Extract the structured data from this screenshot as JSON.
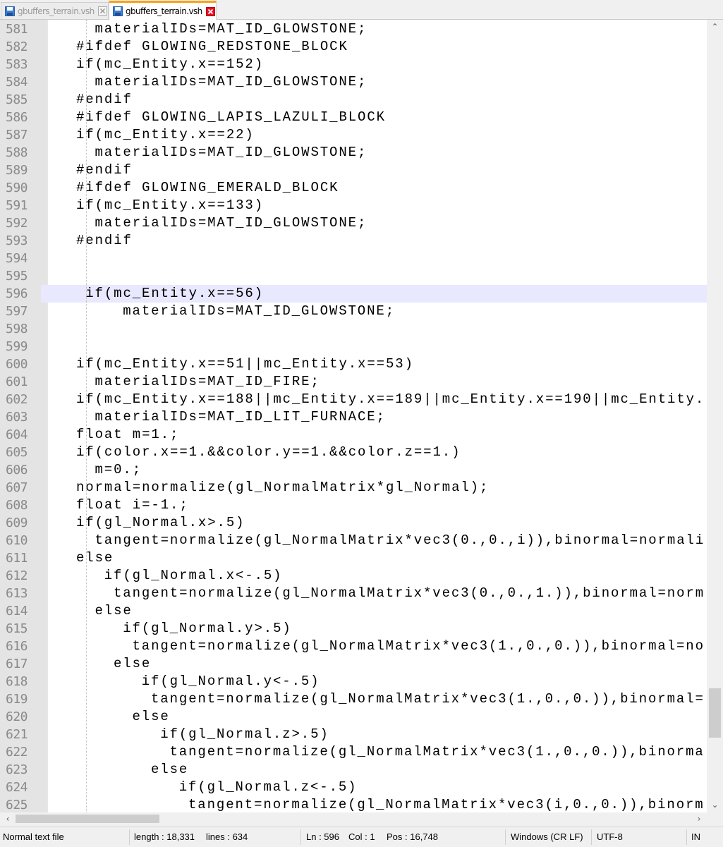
{
  "tabs": [
    {
      "label": "gbuffers_terrain.vsh",
      "active": false,
      "icon": "save-disk-icon",
      "close_icon": "close-red-icon"
    },
    {
      "label": "gbuffers_terrain.vsh",
      "active": true,
      "icon": "save-disk-icon",
      "close_icon": "close-red-icon"
    }
  ],
  "editor": {
    "current_line": 596,
    "lines": [
      {
        "n": "581",
        "indent": 5,
        "text": "materialIDs=MAT_ID_GLOWSTONE;"
      },
      {
        "n": "582",
        "indent": 4,
        "text": "#ifdef GLOWING_REDSTONE_BLOCK"
      },
      {
        "n": "583",
        "indent": 4,
        "text": "if(mc_Entity.x==152)"
      },
      {
        "n": "584",
        "indent": 5,
        "text": "materialIDs=MAT_ID_GLOWSTONE;"
      },
      {
        "n": "585",
        "indent": 4,
        "text": "#endif"
      },
      {
        "n": "586",
        "indent": 4,
        "text": "#ifdef GLOWING_LAPIS_LAZULI_BLOCK"
      },
      {
        "n": "587",
        "indent": 4,
        "text": "if(mc_Entity.x==22)"
      },
      {
        "n": "588",
        "indent": 5,
        "text": "materialIDs=MAT_ID_GLOWSTONE;"
      },
      {
        "n": "589",
        "indent": 4,
        "text": "#endif"
      },
      {
        "n": "590",
        "indent": 4,
        "text": "#ifdef GLOWING_EMERALD_BLOCK"
      },
      {
        "n": "591",
        "indent": 4,
        "text": "if(mc_Entity.x==133)"
      },
      {
        "n": "592",
        "indent": 5,
        "text": "materialIDs=MAT_ID_GLOWSTONE;"
      },
      {
        "n": "593",
        "indent": 4,
        "text": "#endif"
      },
      {
        "n": "594",
        "indent": 0,
        "text": ""
      },
      {
        "n": "595",
        "indent": 0,
        "text": ""
      },
      {
        "n": "596",
        "indent": 4.5,
        "text": "if(mc_Entity.x==56)"
      },
      {
        "n": "597",
        "indent": 6.5,
        "text": "materialIDs=MAT_ID_GLOWSTONE;"
      },
      {
        "n": "598",
        "indent": 0,
        "text": ""
      },
      {
        "n": "599",
        "indent": 0,
        "text": ""
      },
      {
        "n": "600",
        "indent": 4,
        "text": "if(mc_Entity.x==51||mc_Entity.x==53)"
      },
      {
        "n": "601",
        "indent": 5,
        "text": "materialIDs=MAT_ID_FIRE;"
      },
      {
        "n": "602",
        "indent": 4,
        "text": "if(mc_Entity.x==188||mc_Entity.x==189||mc_Entity.x==190||mc_Entity."
      },
      {
        "n": "603",
        "indent": 5,
        "text": "materialIDs=MAT_ID_LIT_FURNACE;"
      },
      {
        "n": "604",
        "indent": 4,
        "text": "float m=1.;"
      },
      {
        "n": "605",
        "indent": 4,
        "text": "if(color.x==1.&&color.y==1.&&color.z==1.)"
      },
      {
        "n": "606",
        "indent": 5,
        "text": "m=0.;"
      },
      {
        "n": "607",
        "indent": 4,
        "text": "normal=normalize(gl_NormalMatrix*gl_Normal);"
      },
      {
        "n": "608",
        "indent": 4,
        "text": "float i=-1.;"
      },
      {
        "n": "609",
        "indent": 4,
        "text": "if(gl_Normal.x>.5)"
      },
      {
        "n": "610",
        "indent": 5,
        "text": "tangent=normalize(gl_NormalMatrix*vec3(0.,0.,i)),binormal=normali"
      },
      {
        "n": "611",
        "indent": 4,
        "text": "else"
      },
      {
        "n": "612",
        "indent": 5.5,
        "text": "if(gl_Normal.x<-.5)"
      },
      {
        "n": "613",
        "indent": 6,
        "text": "tangent=normalize(gl_NormalMatrix*vec3(0.,0.,1.)),binormal=norm"
      },
      {
        "n": "614",
        "indent": 5,
        "text": "else"
      },
      {
        "n": "615",
        "indent": 6.5,
        "text": "if(gl_Normal.y>.5)"
      },
      {
        "n": "616",
        "indent": 7,
        "text": "tangent=normalize(gl_NormalMatrix*vec3(1.,0.,0.)),binormal=no"
      },
      {
        "n": "617",
        "indent": 6,
        "text": "else"
      },
      {
        "n": "618",
        "indent": 7.5,
        "text": "if(gl_Normal.y<-.5)"
      },
      {
        "n": "619",
        "indent": 8,
        "text": "tangent=normalize(gl_NormalMatrix*vec3(1.,0.,0.)),binormal="
      },
      {
        "n": "620",
        "indent": 7,
        "text": "else"
      },
      {
        "n": "621",
        "indent": 8.5,
        "text": "if(gl_Normal.z>.5)"
      },
      {
        "n": "622",
        "indent": 9,
        "text": "tangent=normalize(gl_NormalMatrix*vec3(1.,0.,0.)),binorma"
      },
      {
        "n": "623",
        "indent": 8,
        "text": "else"
      },
      {
        "n": "624",
        "indent": 9.5,
        "text": "if(gl_Normal.z<-.5)"
      },
      {
        "n": "625",
        "indent": 10,
        "text": "tangent=normalize(gl_NormalMatrix*vec3(i,0.,0.)),binorm"
      }
    ]
  },
  "statusbar": {
    "file_type": "Normal text file",
    "length": "length : 18,331",
    "lines": "lines : 634",
    "ln": "Ln : 596",
    "col": "Col : 1",
    "pos": "Pos : 16,748",
    "eol": "Windows (CR LF)",
    "encoding": "UTF-8",
    "mode": "IN"
  },
  "colors": {
    "accent_tab": "#f7a21b",
    "current_line": "#e8e8ff",
    "gutter": "#e4e4e4",
    "close_icon": "#e81123"
  }
}
